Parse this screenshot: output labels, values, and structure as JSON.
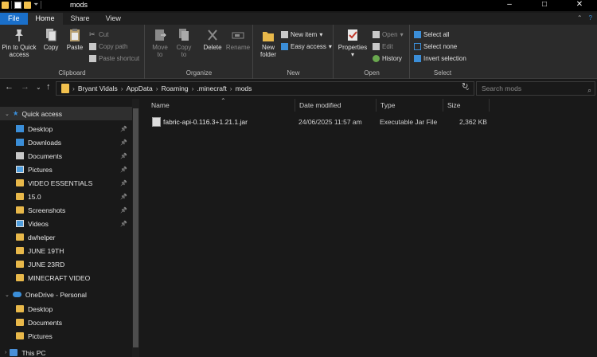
{
  "window": {
    "title": "mods",
    "controls": [
      "–",
      "□",
      "✕"
    ]
  },
  "tabs": [
    "File",
    "Home",
    "Share",
    "View"
  ],
  "ribbon": {
    "clipboard": {
      "pin_label_1": "Pin to Quick",
      "pin_label_2": "access",
      "copy": "Copy",
      "paste": "Paste",
      "cut": "Cut",
      "copy_path": "Copy path",
      "paste_shortcut": "Paste shortcut",
      "group_label": "Clipboard"
    },
    "organize": {
      "move_to_1": "Move",
      "move_to_2": "to",
      "copy_to_1": "Copy",
      "copy_to_2": "to",
      "delete": "Delete",
      "rename": "Rename",
      "group_label": "Organize"
    },
    "new": {
      "new_folder_1": "New",
      "new_folder_2": "folder",
      "new_item": "New item",
      "easy_access": "Easy access",
      "group_label": "New"
    },
    "open": {
      "properties": "Properties",
      "open": "Open",
      "edit": "Edit",
      "history": "History",
      "group_label": "Open"
    },
    "select": {
      "select_all": "Select all",
      "select_none": "Select none",
      "invert": "Invert selection",
      "group_label": "Select"
    }
  },
  "address": {
    "crumbs": [
      "Bryant Vidals",
      "AppData",
      "Roaming",
      ".minecraft",
      "mods"
    ],
    "search_placeholder": "Search mods"
  },
  "nav": {
    "quick_access": "Quick access",
    "items": [
      {
        "label": "Desktop",
        "pinned": true
      },
      {
        "label": "Downloads",
        "pinned": true
      },
      {
        "label": "Documents",
        "pinned": true
      },
      {
        "label": "Pictures",
        "pinned": true
      },
      {
        "label": "VIDEO ESSENTIALS",
        "pinned": true
      },
      {
        "label": "15.0",
        "pinned": true
      },
      {
        "label": "Screenshots",
        "pinned": true
      },
      {
        "label": "Videos",
        "pinned": true
      },
      {
        "label": "dwhelper",
        "pinned": false
      },
      {
        "label": "JUNE 19TH",
        "pinned": false
      },
      {
        "label": "JUNE 23RD",
        "pinned": false
      },
      {
        "label": "MINECRAFT VIDEO",
        "pinned": false
      }
    ],
    "onedrive": "OneDrive - Personal",
    "onedrive_items": [
      "Desktop",
      "Documents",
      "Pictures"
    ],
    "this_pc": "This PC"
  },
  "columns": {
    "name": "Name",
    "date": "Date modified",
    "type": "Type",
    "size": "Size"
  },
  "files": [
    {
      "name": "fabric-api-0.116.3+1.21.1.jar",
      "date": "24/06/2025 11:57 am",
      "type": "Executable Jar File",
      "size": "2,362 KB"
    }
  ]
}
